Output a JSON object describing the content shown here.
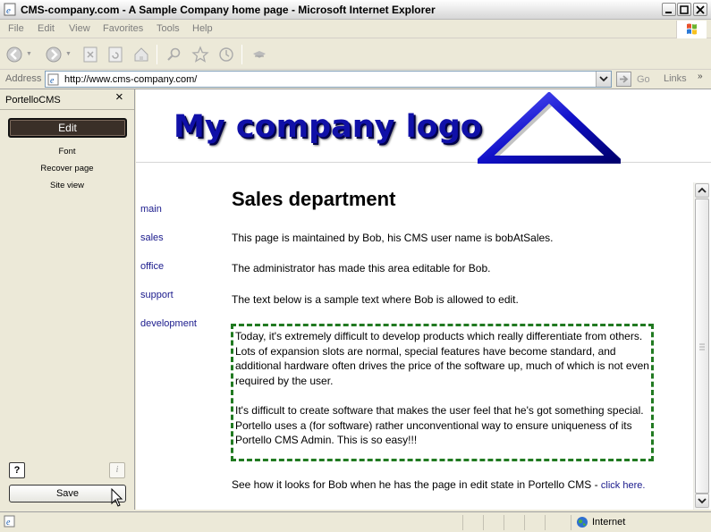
{
  "window": {
    "title": "CMS-company.com - A Sample Company home page - Microsoft Internet Explorer"
  },
  "menu": [
    "File",
    "Edit",
    "View",
    "Favorites",
    "Tools",
    "Help"
  ],
  "address": {
    "label": "Address",
    "url": "http://www.cms-company.com/",
    "go_label": "Go",
    "links_label": "Links"
  },
  "sidebar": {
    "title": "PortelloCMS",
    "close": "×",
    "edit_label": "Edit",
    "links": [
      "Font",
      "Recover page",
      "Site view"
    ],
    "help": "?",
    "info": "i",
    "save_label": "Save"
  },
  "page": {
    "logo_text": "My company logo",
    "nav": [
      "main",
      "sales",
      "office",
      "support",
      "development"
    ],
    "heading": "Sales department",
    "paragraphs": [
      "This page is maintained by Bob, his CMS user name is bobAtSales.",
      "The administrator has made this area editable for Bob.",
      "The text below is a sample text where Bob is allowed to edit."
    ],
    "editable": [
      "Today, it's extremely difficult to develop products which really differentiate from others. Lots of expansion slots are normal, special features have become standard, and additional hardware often drives the price of the software up, much of which is not even required by the user.",
      "It's difficult to create software that makes the user feel that he's got something special. Portello uses a (for software) rather unconventional way to ensure uniqueness of its Portello CMS Admin. This is so easy!!!"
    ],
    "footer_text": "See how it looks for Bob when he has the page in edit state in Portello CMS - ",
    "footer_link": "click here."
  },
  "status": {
    "zone": "Internet"
  },
  "colors": {
    "logo_blue": "#1010a8",
    "edit_border": "#217a21",
    "nav_link": "#1a1a8c",
    "edit_button_bg": "#3a2f28"
  },
  "icons": [
    "ie-page-icon",
    "minimize-icon",
    "maximize-icon",
    "close-icon",
    "back-icon",
    "forward-icon",
    "stop-icon",
    "refresh-icon",
    "home-icon",
    "search-icon",
    "favorites-icon",
    "history-icon",
    "mail-icon",
    "windows-flag-icon",
    "go-arrow-icon",
    "globe-icon"
  ]
}
